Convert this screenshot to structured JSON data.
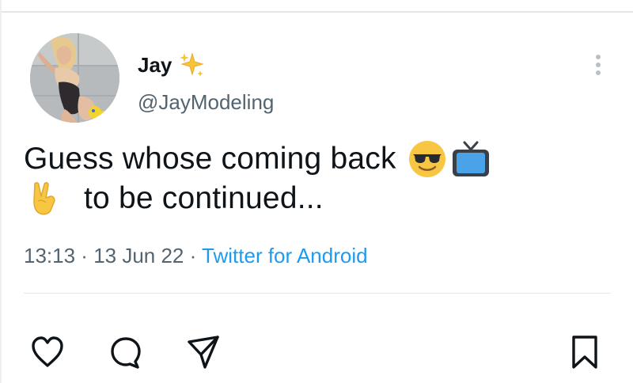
{
  "tweet": {
    "display_name": "Jay",
    "name_emoji_icon": "sparkles-icon",
    "handle": "@JayModeling",
    "line1_text": "Guess whose coming back",
    "line1_icons": [
      "smiling-face-with-sunglasses-icon",
      "television-icon"
    ],
    "line2_icon": "victory-hand-icon",
    "line2_text": "to be continued...",
    "time": "13:13",
    "separator": " · ",
    "date": "13 Jun 22",
    "source": "Twitter for Android"
  },
  "actions": [
    "heart-icon",
    "reply-icon",
    "share-icon",
    "bookmark-icon"
  ],
  "colors": {
    "text": "#0f1419",
    "secondary": "#536471",
    "link": "#1d9bf0",
    "divider": "#e6e9eb"
  }
}
